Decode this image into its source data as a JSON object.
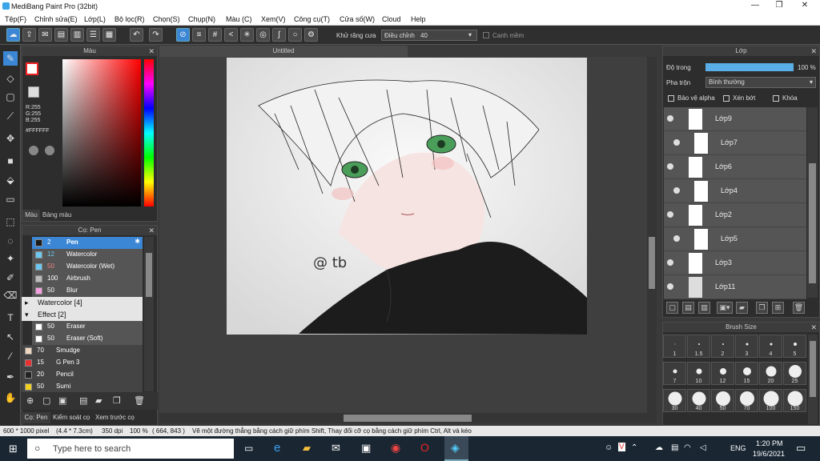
{
  "window": {
    "title": "MediBang Paint Pro (32bit)"
  },
  "menu": [
    "Tệp(F)",
    "Chỉnh sửa(E)",
    "Lớp(L)",
    "Bộ lọc(R)",
    "Chọn(S)",
    "Chụp(N)",
    "Màu (C)",
    "Xem(V)",
    "Công cụ(T)",
    "Cửa số(W)",
    "Cloud",
    "Help"
  ],
  "toolbar": {
    "antialias": "Khử răng cưa",
    "adjust": "Điều chỉnh",
    "adjust_value": "40",
    "canh_mem": "Canh mềm"
  },
  "color_panel": {
    "title": "Màu",
    "r": "R:255",
    "g": "G:255",
    "b": "B:255",
    "hex": "#FFFFFF",
    "tab1": "Màu",
    "tab2": "Bảng màu"
  },
  "brush_panel": {
    "title": "Cọ: Pen",
    "items": [
      {
        "n": "2",
        "l": "Pen",
        "c": "#1a1a1a",
        "sel": true
      },
      {
        "n": "12",
        "l": "Watercolor",
        "c": "#6cc8f0"
      },
      {
        "n": "50",
        "l": "Watercolor (Wet)",
        "c": "#6cc8f0"
      },
      {
        "n": "100",
        "l": "Airbrush",
        "c": "#bbbbbb"
      },
      {
        "n": "50",
        "l": "Blur",
        "c": "#f4a0e0"
      }
    ],
    "group1": "Watercolor [4]",
    "group2": "Effect [2]",
    "items2": [
      {
        "n": "50",
        "l": "Eraser",
        "c": "#ffffff"
      },
      {
        "n": "50",
        "l": "Eraser (Soft)",
        "c": "#ffffff"
      }
    ],
    "items3": [
      {
        "n": "70",
        "l": "Smudge",
        "c": "#f0d8c0"
      },
      {
        "n": "15",
        "l": "G Pen 3",
        "c": "#e83030"
      },
      {
        "n": "20",
        "l": "Pencil",
        "c": "#222222"
      },
      {
        "n": "50",
        "l": "Sumi",
        "c": "#f0d020"
      }
    ],
    "tabs": [
      "Cọ: Pen",
      "Kiểm soát cọ",
      "Xem trước cọ"
    ]
  },
  "document": {
    "tab": "Untitled",
    "signature": "@ tb"
  },
  "layer_panel": {
    "title": "Lớp",
    "opacity_label": "Độ trong",
    "opacity_value": "100 %",
    "blend_label": "Pha trộn",
    "blend_value": "Bình thường",
    "protect_alpha": "Bảo vệ alpha",
    "clip": "Xén bớt",
    "lock": "Khóa",
    "layers": [
      "Lớp9",
      "Lớp7",
      "Lớp6",
      "Lớp4",
      "Lớp2",
      "Lớp5",
      "Lớp3",
      "Lớp11"
    ]
  },
  "brush_size": {
    "title": "Brush Size",
    "sizes": [
      "1",
      "1.5",
      "2",
      "3",
      "4",
      "5",
      "7",
      "10",
      "12",
      "15",
      "20",
      "25",
      "30",
      "40",
      "50",
      "70",
      "100",
      "150"
    ]
  },
  "status": {
    "size": "600 * 1000 pixel",
    "phys": "(4.4 * 7.3cm)",
    "dpi": "350 dpi",
    "zoom": "100 %",
    "coord": "( 664, 843 )",
    "hint": "Vẽ một đường thẳng bằng cách giữ phím Shift, Thay đổi cỡ cọ bằng cách giữ phím Ctrl, Alt và kéo"
  },
  "taskbar": {
    "search": "Type here to search",
    "lang": "ENG",
    "time": "1:20 PM",
    "date": "19/6/2021"
  }
}
